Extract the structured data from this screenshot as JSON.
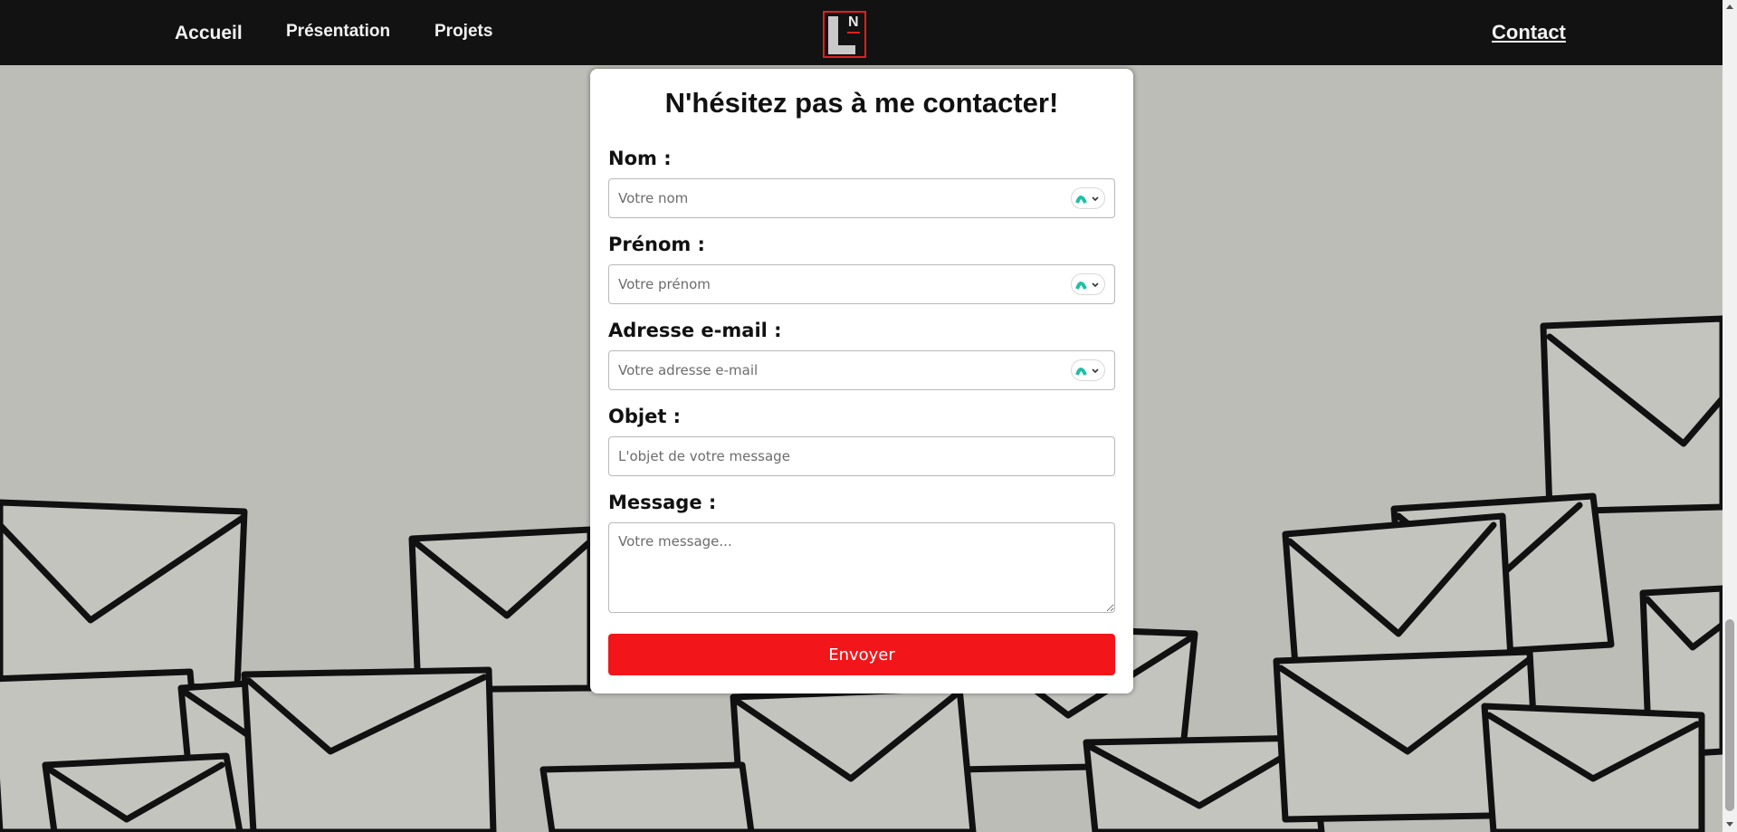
{
  "nav": {
    "home": "Accueil",
    "presentation": "Présentation",
    "projects": "Projets",
    "contact": "Contact",
    "logo_letter_main": "L",
    "logo_letter_small": "N"
  },
  "form": {
    "title": "N'hésitez pas à me contacter!",
    "fields": [
      {
        "label": "Nom :",
        "placeholder": "Votre nom"
      },
      {
        "label": "Prénom :",
        "placeholder": "Votre prénom"
      },
      {
        "label": "Adresse e-mail :",
        "placeholder": "Votre adresse e-mail"
      },
      {
        "label": "Objet :",
        "placeholder": "L'objet de votre message"
      },
      {
        "label": "Message :",
        "placeholder": "Votre message..."
      }
    ],
    "submit": "Envoyer"
  },
  "colors": {
    "nav_bg": "#121212",
    "accent": "#f2161b",
    "password_manager_icon": "#1fbfa6"
  },
  "icons": [
    "password-manager-icon",
    "scroll-up-arrow-icon",
    "scroll-down-arrow-icon"
  ]
}
